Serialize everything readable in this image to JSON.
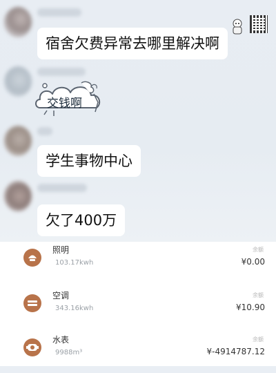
{
  "chat": {
    "messages": [
      {
        "type": "text",
        "text": "宿舍欠费异常去哪里解决啊"
      },
      {
        "type": "sticker",
        "text": "交钱啊"
      },
      {
        "type": "text",
        "text": "学生事物中心"
      },
      {
        "type": "text",
        "text": "欠了400万"
      }
    ]
  },
  "bills": [
    {
      "name": "照明",
      "usage": "103.17kwh",
      "tag": "余额",
      "amount": "¥0.00",
      "icon": "lamp-icon",
      "color": "#b8734a"
    },
    {
      "name": "空调",
      "usage": "343.16kwh",
      "tag": "余额",
      "amount": "¥10.90",
      "icon": "air-conditioner-icon",
      "color": "#b8734a"
    },
    {
      "name": "水表",
      "usage": "9988m³",
      "tag": "余额",
      "amount": "¥-4914787.12",
      "icon": "water-meter-icon",
      "color": "#b8734a"
    }
  ]
}
